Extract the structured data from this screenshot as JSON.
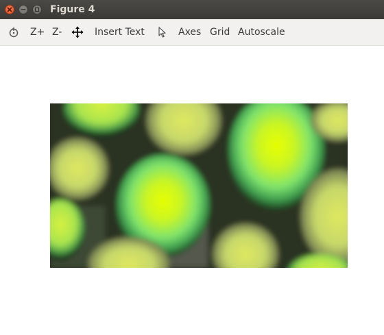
{
  "window": {
    "title": "Figure 4"
  },
  "toolbar": {
    "reset_icon": "reset-view-icon",
    "zoom_in_label": "Z+",
    "zoom_out_label": "Z-",
    "pan_icon": "move-arrows-icon",
    "insert_text_label": "Insert Text",
    "select_icon": "cursor-pointer-icon",
    "axes_label": "Axes",
    "grid_label": "Grid",
    "autoscale_label": "Autoscale"
  },
  "figure": {
    "content": "blurred pixelated image of green-yellow cells on dark background",
    "colors": {
      "background_dark": "#1f2a1a",
      "cell_edge": "#2f6b3a",
      "cell_mid": "#7be06a",
      "cell_core": "#e6ff00",
      "pale_cell": "#c8d878"
    }
  }
}
